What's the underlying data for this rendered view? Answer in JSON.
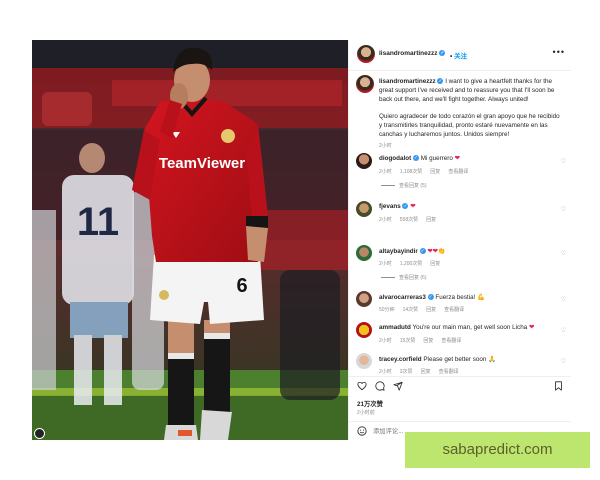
{
  "post": {
    "username": "lisandromartinezzz",
    "follow_label": "关注",
    "caption_en": "I want to give a heartfelt thanks for the great support I've received and to reassure you that I'll soon be back out there, and we'll fight together. Always united!",
    "caption_es": "Quiero agradecer de todo corazón el gran apoyo que he recibido y transmitirles tranquilidad, pronto estaré nuevamente en las canchas y lucharemos juntos. Unidos siempre!",
    "caption_time": "2小时",
    "likes": "21万次赞",
    "date": "2小时前",
    "comment_placeholder": "添加评论..."
  },
  "photo": {
    "jersey_sponsor": "TeamViewer",
    "shirt_number": "6",
    "background_player_number": "11"
  },
  "comments": [
    {
      "user": "diogodalot",
      "text": "Mi guerrero",
      "emoji": "❤",
      "time": "2小时",
      "likes": "1,108次赞",
      "reply": "回复",
      "translate": "查看翻译",
      "replies": "查看回复 (5)"
    },
    {
      "user": "fjevans",
      "text": "",
      "emoji": "❤",
      "time": "2小时",
      "likes": "558次赞",
      "reply": "回复",
      "translate": "",
      "replies": ""
    },
    {
      "user": "altaybayindir",
      "text": "",
      "emoji": "❤❤👏",
      "time": "2小时",
      "likes": "1,200次赞",
      "reply": "回复",
      "translate": "",
      "replies": "查看回复 (6)"
    },
    {
      "user": "alvarocarreras3",
      "text": "Fuerza bestia!",
      "emoji": "💪",
      "time": "50分钟",
      "likes": "14次赞",
      "reply": "回复",
      "translate": "查看翻译",
      "replies": ""
    },
    {
      "user": "ammadutd",
      "text": "You're our main man, get well soon Licha",
      "emoji": "❤",
      "time": "2小时",
      "likes": "15次赞",
      "reply": "回复",
      "translate": "查看翻译",
      "replies": ""
    },
    {
      "user": "tracey.corfield",
      "text": "Please get better soon",
      "emoji": "🙏",
      "time": "2小时",
      "likes": "3次赞",
      "reply": "回复",
      "translate": "查看翻译",
      "replies": ""
    }
  ],
  "watermark": {
    "text": "sabapredict.com"
  },
  "icons": {
    "more": "more-icon",
    "verified": "verified-badge-icon",
    "heart": "heart-icon",
    "comment": "comment-icon",
    "share": "share-icon",
    "bookmark": "bookmark-icon",
    "emoji": "emoji-icon"
  },
  "colors": {
    "link": "#0095f6",
    "verified": "#3897f0",
    "heart": "#e0245e",
    "watermark_bg": "#bde66f",
    "jersey": "#c8102e"
  }
}
